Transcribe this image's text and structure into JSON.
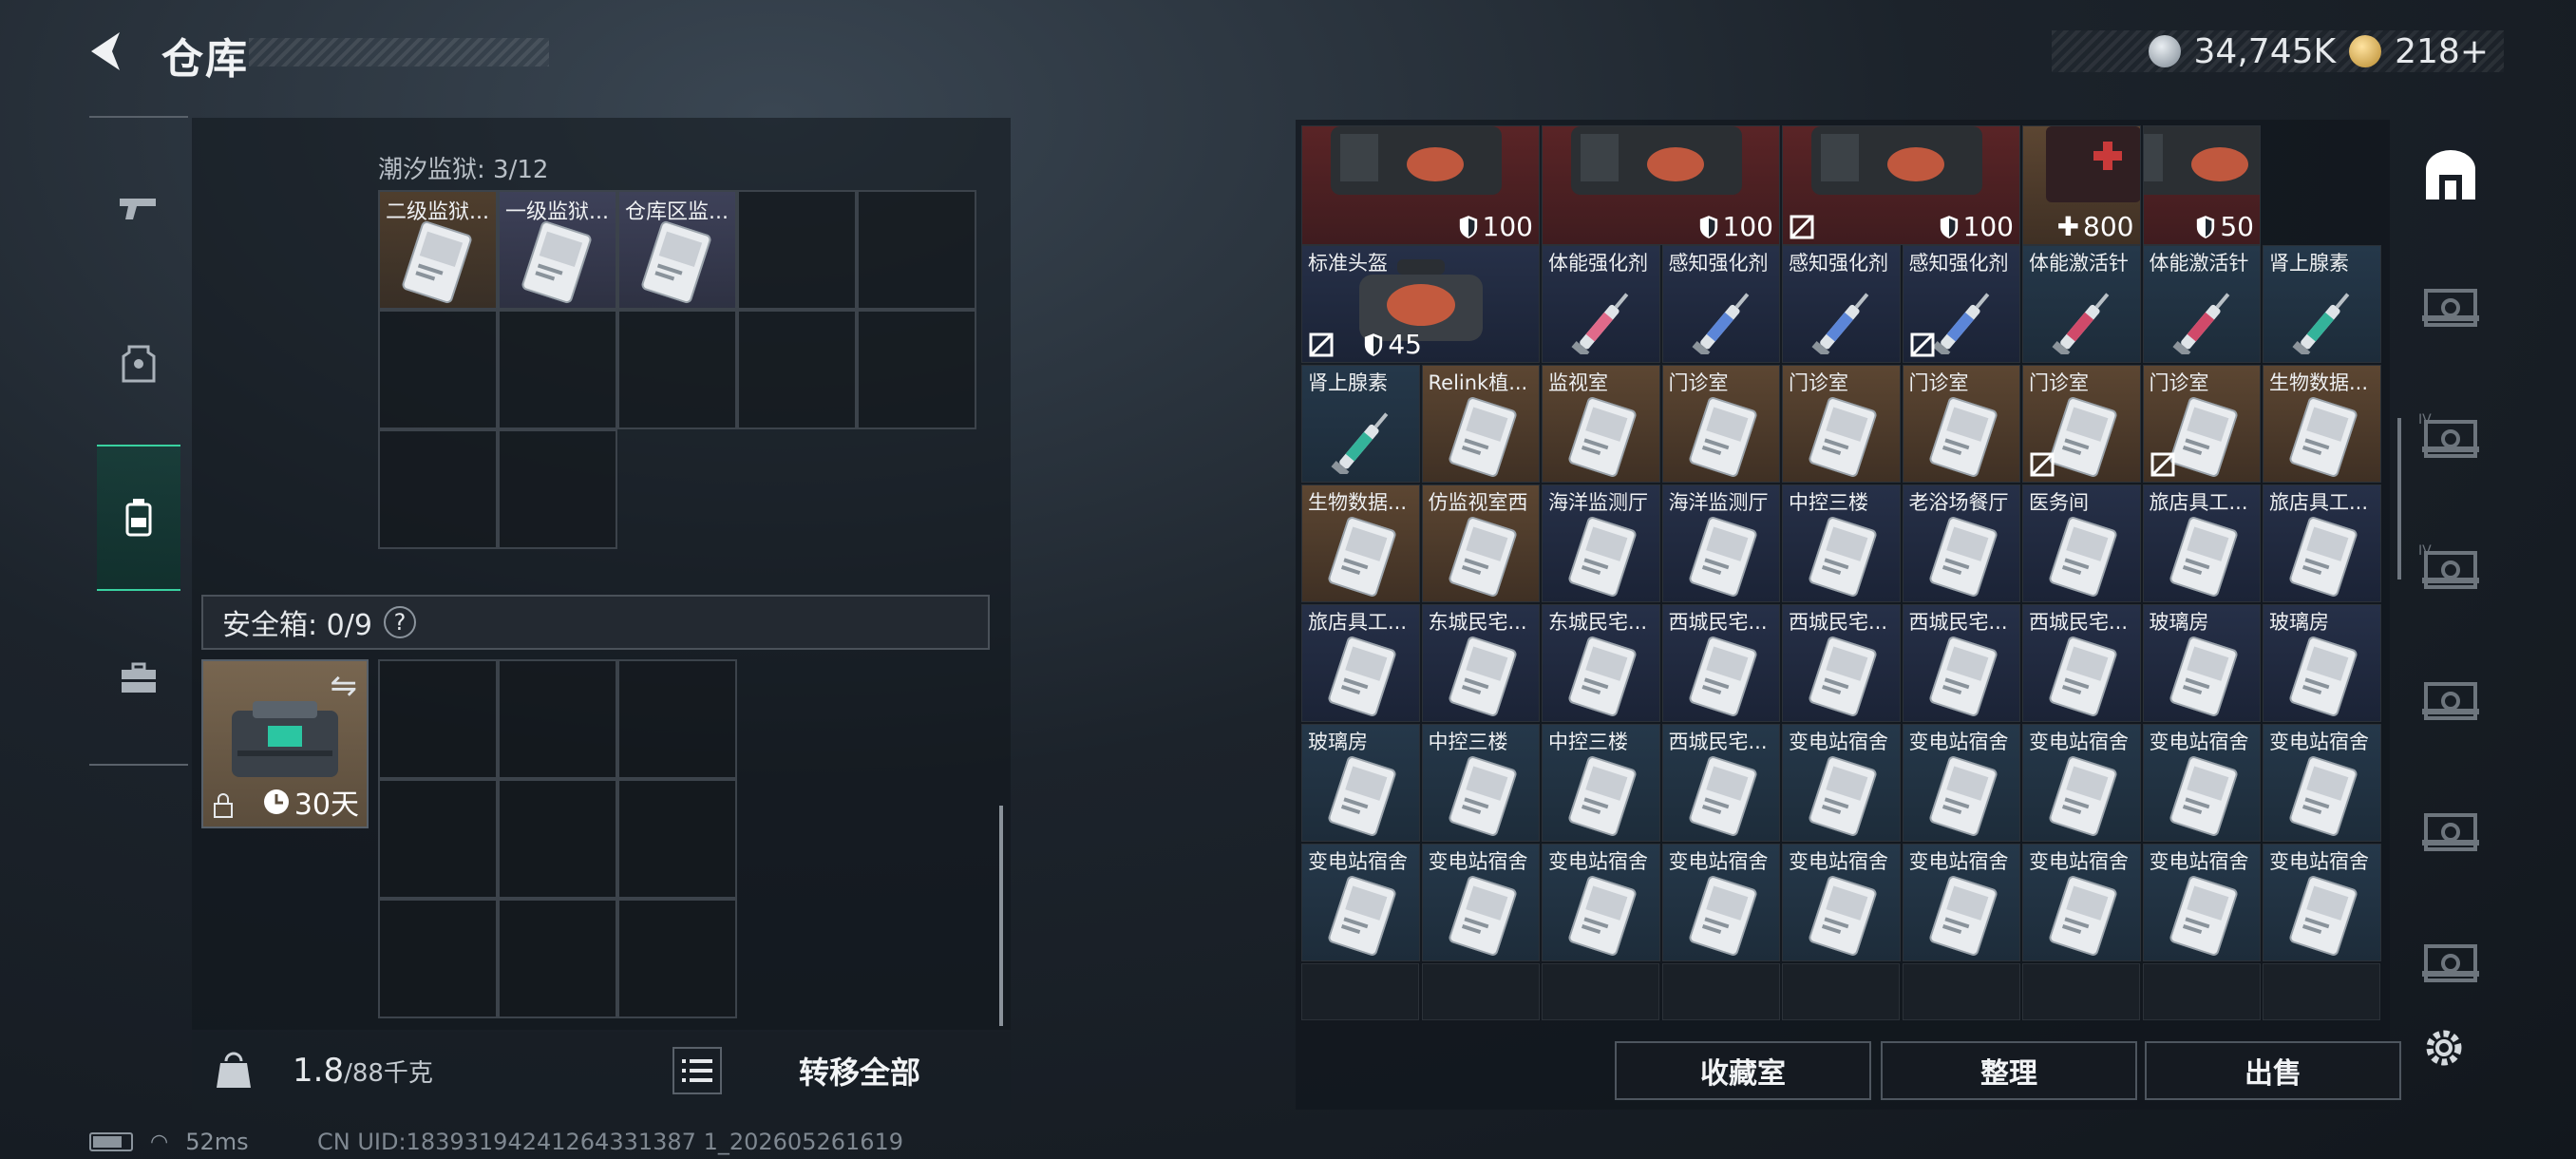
{
  "header": {
    "title": "仓库"
  },
  "currency": {
    "silver": "34,745K",
    "gold": "218+"
  },
  "left_nav": [
    "weapon",
    "armor",
    "backpack",
    "toolbox"
  ],
  "left_panel": {
    "subsection": "潮汐监狱: 3/12",
    "items": [
      {
        "label": "二级监狱...",
        "bg": "brown"
      },
      {
        "label": "一级监狱...",
        "bg": "lavender"
      },
      {
        "label": "仓库区监...",
        "bg": "lavender"
      }
    ],
    "safe": {
      "title": "安全箱: 0/9",
      "help": "?",
      "timer": "30天"
    },
    "weight": {
      "current": "1.8",
      "max": "/88千克"
    },
    "transfer_all": "转移全部"
  },
  "status": {
    "ping": "52ms",
    "uid": "CN UID:18393194241264331387 1_202605261619"
  },
  "right_panel": {
    "top_row": [
      {
        "value": "100",
        "icon": "shield",
        "nodrop": false
      },
      {
        "value": "100",
        "icon": "shield",
        "nodrop": false
      },
      {
        "value": "100",
        "icon": "shield",
        "nodrop": true
      },
      {
        "value": "800",
        "icon": "plus",
        "nodrop": false
      },
      {
        "value": "50",
        "icon": "shield",
        "nodrop": false
      }
    ],
    "rows": [
      [
        {
          "label": "标准头盔",
          "type": "bag",
          "bg": "navy",
          "value": "45",
          "nodrop": true,
          "span": 2
        },
        {
          "label": "体能强化剂",
          "type": "syringe",
          "bg": "navy",
          "color": "#e06a8a",
          "nodrop": false
        },
        {
          "label": "感知强化剂",
          "type": "syringe",
          "bg": "navy",
          "color": "#5c86d8",
          "nodrop": false
        },
        {
          "label": "感知强化剂",
          "type": "syringe",
          "bg": "navy",
          "color": "#5c86d8",
          "nodrop": false
        },
        {
          "label": "感知强化剂",
          "type": "syringe",
          "bg": "navy",
          "color": "#5c86d8",
          "nodrop": true
        },
        {
          "label": "体能激活针",
          "type": "syringe",
          "bg": "blue",
          "color": "#d04a6a",
          "nodrop": false
        },
        {
          "label": "体能激活针",
          "type": "syringe",
          "bg": "blue",
          "color": "#d04a6a",
          "nodrop": false
        },
        {
          "label": "肾上腺素",
          "type": "syringe",
          "bg": "blue",
          "color": "#34b39a",
          "nodrop": false
        }
      ],
      [
        {
          "label": "肾上腺素",
          "type": "syringe",
          "bg": "blue",
          "color": "#34b39a",
          "nodrop": false
        },
        {
          "label": "Relink植...",
          "type": "card",
          "bg": "brown",
          "nodrop": false
        },
        {
          "label": "监视室",
          "type": "card",
          "bg": "brown",
          "nodrop": false
        },
        {
          "label": "门诊室",
          "type": "card",
          "bg": "brown",
          "nodrop": false
        },
        {
          "label": "门诊室",
          "type": "card",
          "bg": "brown",
          "nodrop": false
        },
        {
          "label": "门诊室",
          "type": "card",
          "bg": "brown",
          "nodrop": false
        },
        {
          "label": "门诊室",
          "type": "card",
          "bg": "brown",
          "nodrop": true
        },
        {
          "label": "门诊室",
          "type": "card",
          "bg": "brown",
          "nodrop": true
        },
        {
          "label": "生物数据...",
          "type": "card",
          "bg": "brown",
          "nodrop": false
        }
      ],
      [
        {
          "label": "生物数据...",
          "type": "card",
          "bg": "brown"
        },
        {
          "label": "仿监视室西",
          "type": "card",
          "bg": "brown"
        },
        {
          "label": "海洋监测厅",
          "type": "card",
          "bg": "navy"
        },
        {
          "label": "海洋监测厅",
          "type": "card",
          "bg": "navy"
        },
        {
          "label": "中控三楼",
          "type": "card",
          "bg": "navy"
        },
        {
          "label": "老浴场餐厅",
          "type": "card",
          "bg": "navy"
        },
        {
          "label": "医务间",
          "type": "card",
          "bg": "navy"
        },
        {
          "label": "旅店具工...",
          "type": "card",
          "bg": "navy"
        },
        {
          "label": "旅店具工...",
          "type": "card",
          "bg": "navy"
        }
      ],
      [
        {
          "label": "旅店具工...",
          "type": "card",
          "bg": "navy"
        },
        {
          "label": "东城民宅...",
          "type": "card",
          "bg": "navy"
        },
        {
          "label": "东城民宅...",
          "type": "card",
          "bg": "navy"
        },
        {
          "label": "西城民宅...",
          "type": "card",
          "bg": "navy"
        },
        {
          "label": "西城民宅...",
          "type": "card",
          "bg": "navy"
        },
        {
          "label": "西城民宅...",
          "type": "card",
          "bg": "navy"
        },
        {
          "label": "西城民宅...",
          "type": "card",
          "bg": "navy"
        },
        {
          "label": "玻璃房",
          "type": "card",
          "bg": "navy"
        },
        {
          "label": "玻璃房",
          "type": "card",
          "bg": "navy"
        }
      ],
      [
        {
          "label": "玻璃房",
          "type": "card",
          "bg": "blue"
        },
        {
          "label": "中控三楼",
          "type": "card",
          "bg": "blue"
        },
        {
          "label": "中控三楼",
          "type": "card",
          "bg": "blue"
        },
        {
          "label": "西城民宅...",
          "type": "card",
          "bg": "blue"
        },
        {
          "label": "变电站宿舍",
          "type": "card",
          "bg": "blue"
        },
        {
          "label": "变电站宿舍",
          "type": "card",
          "bg": "blue"
        },
        {
          "label": "变电站宿舍",
          "type": "card",
          "bg": "blue"
        },
        {
          "label": "变电站宿舍",
          "type": "card",
          "bg": "blue"
        },
        {
          "label": "变电站宿舍",
          "type": "card",
          "bg": "blue"
        }
      ],
      [
        {
          "label": "变电站宿舍",
          "type": "card",
          "bg": "blue"
        },
        {
          "label": "变电站宿舍",
          "type": "card",
          "bg": "blue"
        },
        {
          "label": "变电站宿舍",
          "type": "card",
          "bg": "blue"
        },
        {
          "label": "变电站宿舍",
          "type": "card",
          "bg": "blue"
        },
        {
          "label": "变电站宿舍",
          "type": "card",
          "bg": "blue"
        },
        {
          "label": "变电站宿舍",
          "type": "card",
          "bg": "blue"
        },
        {
          "label": "变电站宿舍",
          "type": "card",
          "bg": "blue"
        },
        {
          "label": "变电站宿舍",
          "type": "card",
          "bg": "blue"
        },
        {
          "label": "变电站宿舍",
          "type": "card",
          "bg": "blue"
        }
      ]
    ],
    "buttons": {
      "collection": "收藏室",
      "sort": "整理",
      "sell": "出售"
    }
  },
  "right_tabs": [
    "storage-home",
    "storage-tab-2",
    "storage-tab-iv-a",
    "storage-tab-iv-b",
    "storage-tab-5",
    "storage-tab-6",
    "storage-tab-7"
  ]
}
